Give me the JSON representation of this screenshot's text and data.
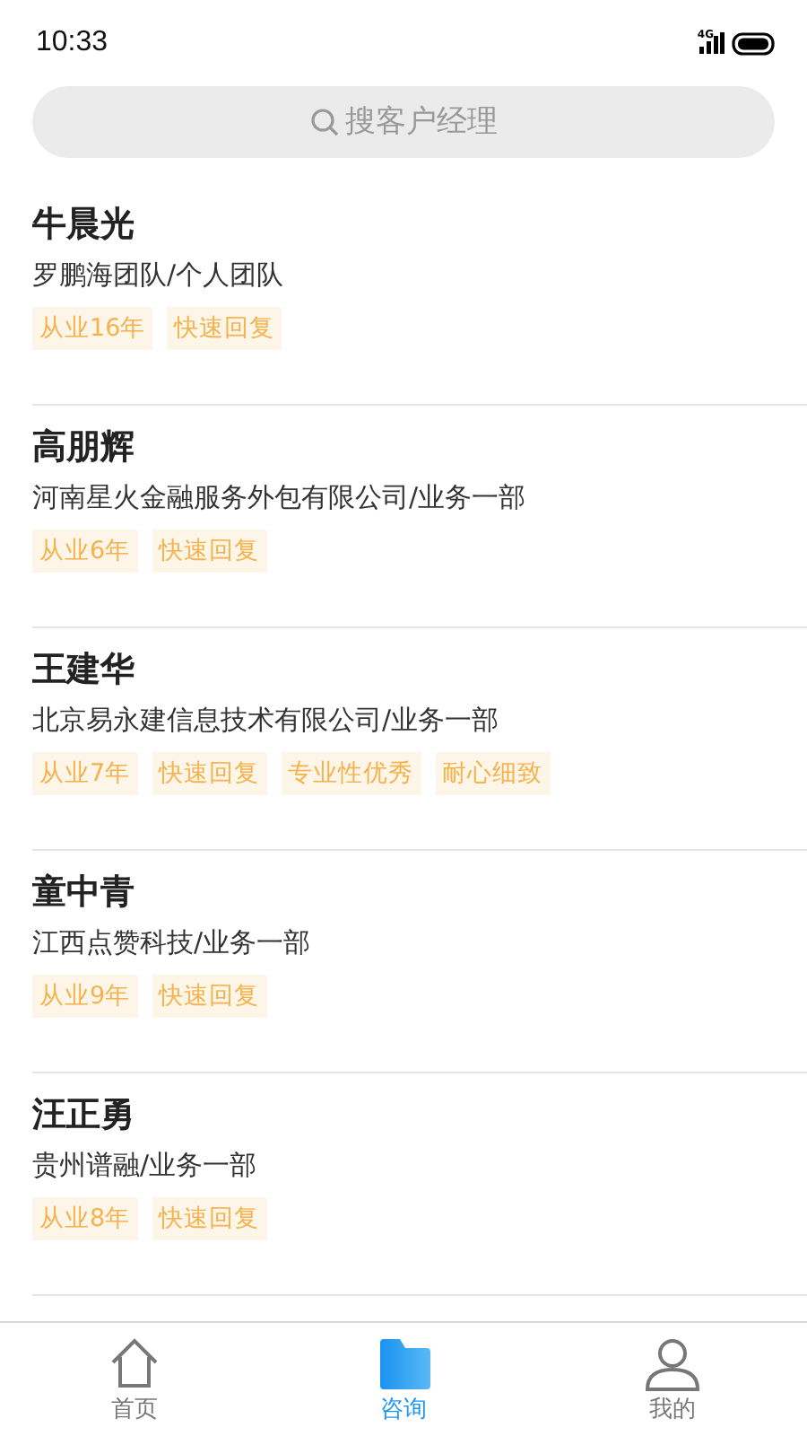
{
  "status_bar": {
    "time": "10:33",
    "network": "4G"
  },
  "search": {
    "placeholder": "搜客户经理"
  },
  "advisors": [
    {
      "name": "牛晨光",
      "org": "罗鹏海团队/个人团队",
      "tags": [
        "从业16年",
        "快速回复"
      ]
    },
    {
      "name": "高朋辉",
      "org": "河南星火金融服务外包有限公司/业务一部",
      "tags": [
        "从业6年",
        "快速回复"
      ]
    },
    {
      "name": "王建华",
      "org": "北京易永建信息技术有限公司/业务一部",
      "tags": [
        "从业7年",
        "快速回复",
        "专业性优秀",
        "耐心细致"
      ]
    },
    {
      "name": "童中青",
      "org": "江西点赞科技/业务一部",
      "tags": [
        "从业9年",
        "快速回复"
      ]
    },
    {
      "name": "汪正勇",
      "org": "贵州谱融/业务一部",
      "tags": [
        "从业8年",
        "快速回复"
      ]
    }
  ],
  "tab_bar": [
    {
      "label": "首页",
      "kind": "home",
      "selected": false
    },
    {
      "label": "咨询",
      "kind": "folder",
      "selected": true
    },
    {
      "label": "我的",
      "kind": "person",
      "selected": false
    }
  ]
}
